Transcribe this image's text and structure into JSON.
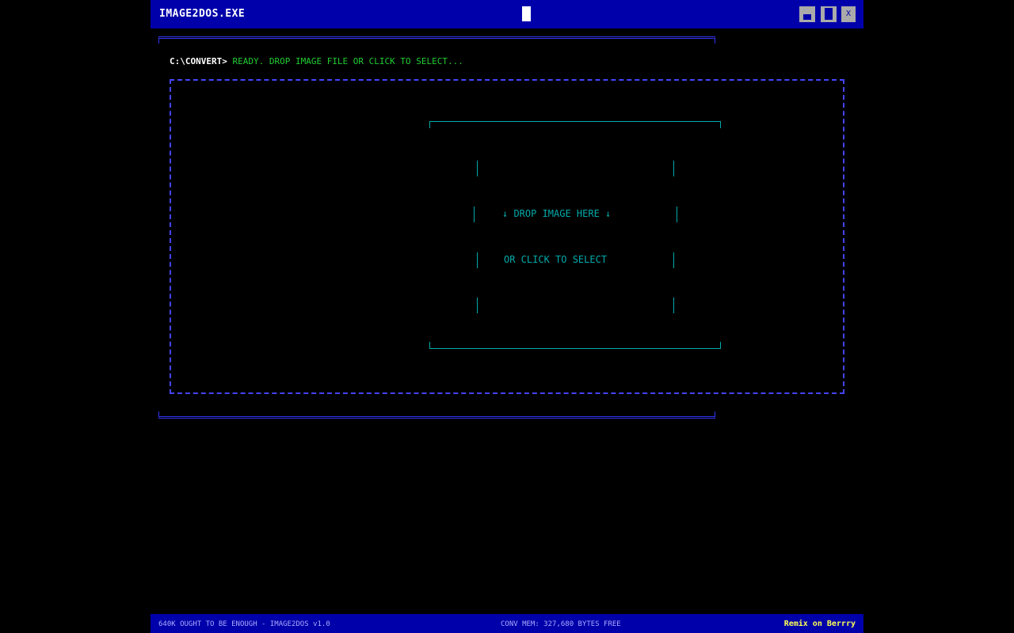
{
  "window": {
    "title": "IMAGE2DOS.EXE",
    "controls": {
      "close_label": "X"
    }
  },
  "prompt": {
    "path": "C:\\CONVERT>",
    "message": "READY. DROP IMAGE FILE OR CLICK TO SELECT..."
  },
  "dropzone": {
    "line1": "↓ DROP IMAGE HERE ↓",
    "line2": "OR CLICK TO SELECT"
  },
  "status": {
    "left": "640K OUGHT TO BE ENOUGH - IMAGE2DOS v1.0",
    "center": "CONV MEM: 327,680 BYTES FREE",
    "right": "Remix on Berrry"
  },
  "colors": {
    "background": "#000000",
    "titlebar": "#0000aa",
    "frame": "#3333ee",
    "dropzone_border": "#4444ff",
    "cyan_text": "#00aaaa",
    "prompt_green": "#22cc33",
    "status_link": "#ffff55"
  }
}
